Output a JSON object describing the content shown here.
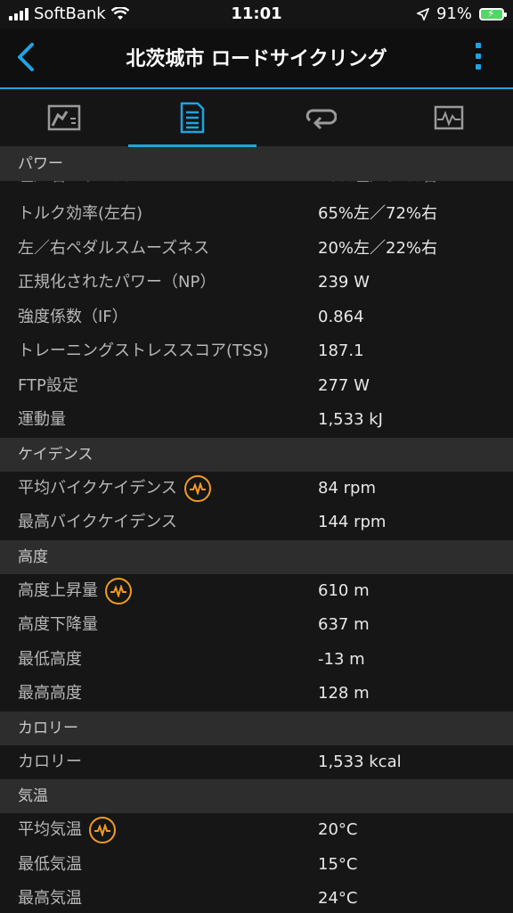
{
  "status_bar": {
    "carrier": "SoftBank",
    "time": "11:01",
    "battery": "91%"
  },
  "header": {
    "title": "北茨城市 ロードサイクリング"
  },
  "tabs": [
    "overview-icon",
    "details-icon",
    "laps-icon",
    "charts-icon"
  ],
  "sections": [
    {
      "title": "パワー",
      "rows": [
        {
          "label": "トルク効率(左右)",
          "value": "65%左／72%右"
        },
        {
          "label": "左／右ペダルスムーズネス",
          "value": "20%左／22%右"
        },
        {
          "label": "正規化されたパワー（NP）",
          "value": "239 W"
        },
        {
          "label": "強度係数（IF）",
          "value": "0.864"
        },
        {
          "label": "トレーニングストレススコア(TSS)",
          "value": "187.1"
        },
        {
          "label": "FTP設定",
          "value": "277 W"
        },
        {
          "label": "運動量",
          "value": "1,533 kJ"
        }
      ]
    },
    {
      "title": "ケイデンス",
      "rows": [
        {
          "label": "平均バイクケイデンス",
          "value": "84 rpm",
          "chart": true
        },
        {
          "label": "最高バイクケイデンス",
          "value": "144 rpm"
        }
      ]
    },
    {
      "title": "高度",
      "rows": [
        {
          "label": "高度上昇量",
          "value": "610 m",
          "chart": true
        },
        {
          "label": "高度下降量",
          "value": "637 m"
        },
        {
          "label": "最低高度",
          "value": "-13 m"
        },
        {
          "label": "最高高度",
          "value": "128 m"
        }
      ]
    },
    {
      "title": "カロリー",
      "rows": [
        {
          "label": "カロリー",
          "value": "1,533 kcal"
        }
      ]
    },
    {
      "title": "気温",
      "rows": [
        {
          "label": "平均気温",
          "value": "20°C",
          "chart": true
        },
        {
          "label": "最低気温",
          "value": "15°C"
        },
        {
          "label": "最高気温",
          "value": "24°C"
        }
      ]
    }
  ]
}
